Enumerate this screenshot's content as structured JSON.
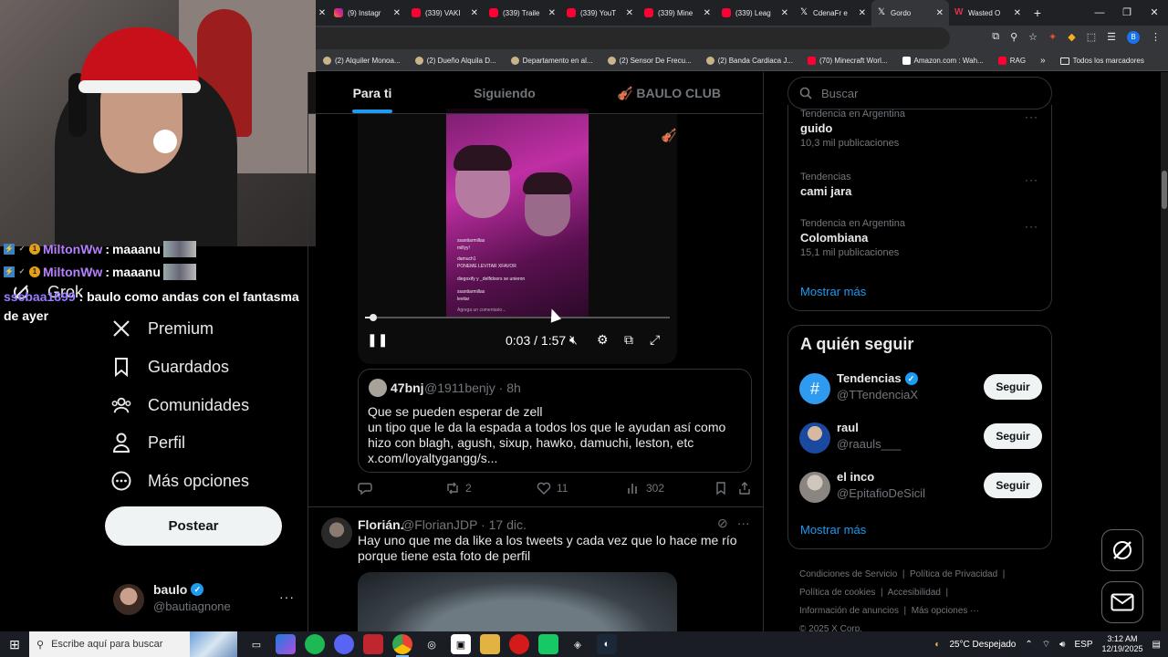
{
  "browser": {
    "tabs": [
      {
        "label": "(9) Instagr",
        "icon": "instagram-icon"
      },
      {
        "label": "(339) VAKI",
        "icon": "youtube-icon"
      },
      {
        "label": "(339) Traile",
        "icon": "youtube-icon"
      },
      {
        "label": "(339) YouT",
        "icon": "youtube-icon"
      },
      {
        "label": "(339) Mine",
        "icon": "youtube-icon"
      },
      {
        "label": "(339) Leag",
        "icon": "youtube-icon"
      },
      {
        "label": "CdenaFr e",
        "icon": "x-icon"
      },
      {
        "label": "Gordo",
        "icon": "x-icon"
      },
      {
        "label": "Wasted O",
        "icon": "wasted-icon"
      }
    ],
    "new_tab": "+",
    "profile_initial": "B",
    "bookmarks": [
      {
        "label": "(2) Alquiler Monoa...",
        "icon": "bookmark-favicon"
      },
      {
        "label": "(2) Dueño Alquila D...",
        "icon": "bookmark-favicon"
      },
      {
        "label": "Departamento en al...",
        "icon": "bookmark-favicon"
      },
      {
        "label": "(2) Sensor De Frecu...",
        "icon": "bookmark-favicon"
      },
      {
        "label": "(2) Banda Cardiaca J...",
        "icon": "bookmark-favicon"
      },
      {
        "label": "(70) Minecraft Worl...",
        "icon": "youtube-icon"
      },
      {
        "label": "Amazon.com : Wah...",
        "icon": "amazon-icon"
      },
      {
        "label": "RAG",
        "icon": "youtube-icon"
      }
    ],
    "bookmarks_more": "»",
    "all_bookmarks": "Todos los marcadores"
  },
  "chat": {
    "line1": {
      "user": "MiltonWw",
      "sep": " : ",
      "msg": "maaanu"
    },
    "line2": {
      "user": "MiltonWw",
      "sep": " : ",
      "msg": "maaanu"
    },
    "line3": {
      "user": "ssebaa1899",
      "sep": " : ",
      "msg": "baulo como andas con el fantasma de ayer"
    }
  },
  "nav": {
    "grok": "Grok",
    "premium": "Premium",
    "guardados": "Guardados",
    "comunidades": "Comunidades",
    "perfil": "Perfil",
    "mas": "Más opciones",
    "post_button": "Postear"
  },
  "account": {
    "name": "baulo",
    "handle": "@bautiagnone",
    "more": "···"
  },
  "timeline": {
    "tabs": [
      "Para ti",
      "Siguiendo",
      "🎻 BAULO CLUB🎻"
    ],
    "video": {
      "time": "0:03 / 1:57",
      "progress": 0.026,
      "comments": [
        "ssantiarmillas",
        "millyy!",
        "damuch1",
        "PONEME LEVITAR XFAVOR",
        "diegoxify y _delfidoors se unieron",
        "ssantiarmillas",
        "levitar",
        "Agrega un comentario..."
      ]
    },
    "quote": {
      "name": "47bnj",
      "handle": "@1911benjy · 8h",
      "text": "Que se pueden esperar de zell\nun tipo que le da la espada a todos los que le ayudan así como hizo con blagh, agush, sixup, hawko, damuchi, leston, etc\nx.com/loyaltygangg/s..."
    },
    "actions": {
      "reply": "",
      "retweets": "2",
      "likes": "11",
      "views": "302"
    },
    "post2": {
      "name": "Florián.",
      "handle": "@FlorianJDP · 17 dic.",
      "text": "Hay uno que me da like a los tweets y cada vez que lo hace me río porque tiene esta foto de perfil",
      "more": "···"
    }
  },
  "sidebar": {
    "search_placeholder": "Buscar",
    "trends": [
      {
        "category": "Tendencia en Argentina",
        "title": "guido",
        "count": "10,3 mil publicaciones"
      },
      {
        "category": "Tendencias",
        "title": "cami jara",
        "count": ""
      },
      {
        "category": "Tendencia en Argentina",
        "title": "Colombiana",
        "count": "15,1 mil publicaciones"
      }
    ],
    "trend_more": "···",
    "show_more": "Mostrar más",
    "who_to_follow": "A quién seguir",
    "follow": [
      {
        "name": "Tendencias",
        "handle": "@TTendenciaX",
        "button": "Seguir",
        "verified": true
      },
      {
        "name": "raul",
        "handle": "@raauls___",
        "button": "Seguir",
        "verified": false
      },
      {
        "name": "el inco",
        "handle": "@EpitafioDeSicil",
        "button": "Seguir",
        "verified": false
      }
    ],
    "show_more2": "Mostrar más",
    "footer": {
      "terms": "Condiciones de Servicio",
      "privacy": "Política de Privacidad",
      "cookies": "Política de cookies",
      "accessibility": "Accesibilidad",
      "ads": "Información de anuncios",
      "more": "Más opciones ···",
      "copyright": "© 2025 X Corp.",
      "sep": "|"
    }
  },
  "taskbar": {
    "search_placeholder": "Escribe aquí para buscar",
    "weather": "25°C  Despejado",
    "lang": "ESP",
    "time": "3:12 AM",
    "date": "12/19/2025"
  },
  "colors": {
    "accent": "#1d9bf0",
    "background": "#000000",
    "muted": "#71767b"
  }
}
